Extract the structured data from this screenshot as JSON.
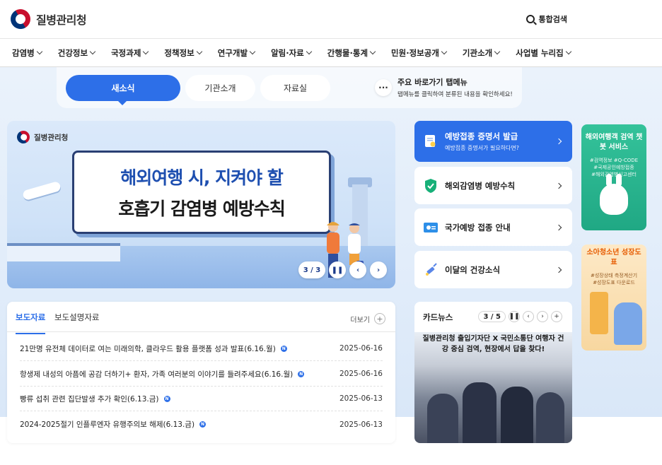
{
  "header": {
    "logo_text": "질병관리청",
    "search_label": "통합검색"
  },
  "gnb": [
    "감염병",
    "건강정보",
    "국정과제",
    "정책정보",
    "연구개발",
    "알림·자료",
    "간행물·통계",
    "민원·정보공개",
    "기관소개",
    "사업별 누리집"
  ],
  "tabs": {
    "items": [
      "새소식",
      "기관소개",
      "자료실"
    ],
    "active": "새소식"
  },
  "quick_menu": {
    "title": "주요 바로가기 탭메뉴",
    "subtitle": "탭메뉴를 클릭하여 분류된 내용을 확인하세요!"
  },
  "banner": {
    "org": "질병관리청",
    "line1": "해외여행 시, 지켜야 할",
    "line2": "호흡기 감염병 예방수칙",
    "page": "3 / 3"
  },
  "quick_cards": [
    {
      "label": "예방접종 증명서 발급",
      "sub": "예방접종 증명서가 필요하다면?"
    },
    {
      "label": "해외감염병 예방수칙"
    },
    {
      "label": "국가예방 접종 안내"
    },
    {
      "label": "이달의 건강소식"
    }
  ],
  "side_ads": [
    {
      "title": "해외여행객 검역 챗봇 서비스",
      "tags": [
        "#검역정보 #Q-CODE",
        "#국제공인예방접종",
        "#해외감염병신고센터"
      ]
    },
    {
      "title": "소아청소년 성장도표",
      "tags": [
        "#성장상태 측정계산기",
        "#성장도표 다운로드"
      ]
    }
  ],
  "news": {
    "tabs": [
      "보도자료",
      "보도설명자료"
    ],
    "more": "더보기",
    "items": [
      {
        "title": "21만명 유전체 데이터로 여는 미래의학, 클라우드 활용 플랫폼 성과 발표(6.16.월)",
        "date": "2025-06-16"
      },
      {
        "title": "항생제 내성의 아픔에 공감 더하기+ 환자, 가족 여러분의 이야기를 들려주세요(6.16.월)",
        "date": "2025-06-16"
      },
      {
        "title": "빵류 섭취 관련 집단발생 추가 확인(6.13.금)",
        "date": "2025-06-13"
      },
      {
        "title": "2024-2025절기 인플루엔자 유행주의보 해제(6.13.금)",
        "date": "2025-06-13"
      }
    ],
    "badge": "N"
  },
  "cardnews": {
    "title": "카드뉴스",
    "page": "3 / 5",
    "headline": "질병관리청 출입기자단 X 국민소통단 여행자 건강 중심 검역, 현장에서 답을 찾다!"
  },
  "colors": {
    "primary": "#2d6fe8",
    "navy": "#2a3f73",
    "mint": "#20a884"
  }
}
